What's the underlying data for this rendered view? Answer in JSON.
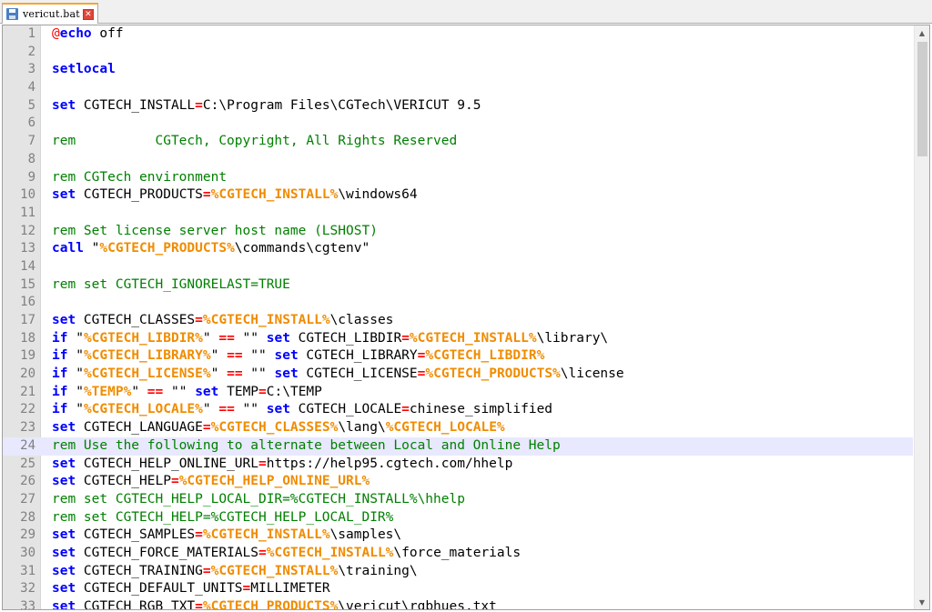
{
  "tab": {
    "filename": "vericut.bat",
    "close_glyph": "✕"
  },
  "scrollbar": {
    "up_glyph": "▲",
    "down_glyph": "▼"
  },
  "editor": {
    "current_line": 24,
    "colors": {
      "keyword": "#0000ff",
      "operator": "#ff0000",
      "variable": "#f08c00",
      "comment": "#008000",
      "gutter": "#e4e4e4",
      "current_line_bg": "#e8e8ff"
    },
    "lines": [
      {
        "n": "1",
        "tokens": [
          [
            "at",
            "@"
          ],
          [
            "kw",
            "echo"
          ],
          [
            "cmd",
            " off"
          ]
        ]
      },
      {
        "n": "2",
        "tokens": []
      },
      {
        "n": "3",
        "tokens": [
          [
            "kw",
            "setlocal"
          ]
        ]
      },
      {
        "n": "4",
        "tokens": []
      },
      {
        "n": "5",
        "tokens": [
          [
            "kw",
            "set"
          ],
          [
            "cmd",
            " CGTECH_INSTALL"
          ],
          [
            "op",
            "="
          ],
          [
            "cmd",
            "C:\\Program Files\\CGTech\\VERICUT 9.5"
          ]
        ]
      },
      {
        "n": "6",
        "tokens": []
      },
      {
        "n": "7",
        "tokens": [
          [
            "rem",
            "rem          CGTech, Copyright, All Rights Reserved"
          ]
        ]
      },
      {
        "n": "8",
        "tokens": []
      },
      {
        "n": "9",
        "tokens": [
          [
            "rem",
            "rem CGTech environment"
          ]
        ]
      },
      {
        "n": "10",
        "tokens": [
          [
            "kw",
            "set"
          ],
          [
            "cmd",
            " CGTECH_PRODUCTS"
          ],
          [
            "op",
            "="
          ],
          [
            "var",
            "%CGTECH_INSTALL%"
          ],
          [
            "cmd",
            "\\windows64"
          ]
        ]
      },
      {
        "n": "11",
        "tokens": []
      },
      {
        "n": "12",
        "tokens": [
          [
            "rem",
            "rem Set license server host name (LSHOST)"
          ]
        ]
      },
      {
        "n": "13",
        "tokens": [
          [
            "kw",
            "call"
          ],
          [
            "cmd",
            " \""
          ],
          [
            "var",
            "%CGTECH_PRODUCTS%"
          ],
          [
            "cmd",
            "\\commands\\cgtenv\""
          ]
        ]
      },
      {
        "n": "14",
        "tokens": []
      },
      {
        "n": "15",
        "tokens": [
          [
            "rem",
            "rem set CGTECH_IGNORELAST=TRUE"
          ]
        ]
      },
      {
        "n": "16",
        "tokens": []
      },
      {
        "n": "17",
        "tokens": [
          [
            "kw",
            "set"
          ],
          [
            "cmd",
            " CGTECH_CLASSES"
          ],
          [
            "op",
            "="
          ],
          [
            "var",
            "%CGTECH_INSTALL%"
          ],
          [
            "cmd",
            "\\classes"
          ]
        ]
      },
      {
        "n": "18",
        "tokens": [
          [
            "kw",
            "if"
          ],
          [
            "cmd",
            " \""
          ],
          [
            "var",
            "%CGTECH_LIBDIR%"
          ],
          [
            "cmd",
            "\" "
          ],
          [
            "op",
            "=="
          ],
          [
            "cmd",
            " \"\" "
          ],
          [
            "kw",
            "set"
          ],
          [
            "cmd",
            " CGTECH_LIBDIR"
          ],
          [
            "op",
            "="
          ],
          [
            "var",
            "%CGTECH_INSTALL%"
          ],
          [
            "cmd",
            "\\library\\"
          ]
        ]
      },
      {
        "n": "19",
        "tokens": [
          [
            "kw",
            "if"
          ],
          [
            "cmd",
            " \""
          ],
          [
            "var",
            "%CGTECH_LIBRARY%"
          ],
          [
            "cmd",
            "\" "
          ],
          [
            "op",
            "=="
          ],
          [
            "cmd",
            " \"\" "
          ],
          [
            "kw",
            "set"
          ],
          [
            "cmd",
            " CGTECH_LIBRARY"
          ],
          [
            "op",
            "="
          ],
          [
            "var",
            "%CGTECH_LIBDIR%"
          ]
        ]
      },
      {
        "n": "20",
        "tokens": [
          [
            "kw",
            "if"
          ],
          [
            "cmd",
            " \""
          ],
          [
            "var",
            "%CGTECH_LICENSE%"
          ],
          [
            "cmd",
            "\" "
          ],
          [
            "op",
            "=="
          ],
          [
            "cmd",
            " \"\" "
          ],
          [
            "kw",
            "set"
          ],
          [
            "cmd",
            " CGTECH_LICENSE"
          ],
          [
            "op",
            "="
          ],
          [
            "var",
            "%CGTECH_PRODUCTS%"
          ],
          [
            "cmd",
            "\\license"
          ]
        ]
      },
      {
        "n": "21",
        "tokens": [
          [
            "kw",
            "if"
          ],
          [
            "cmd",
            " \""
          ],
          [
            "var",
            "%TEMP%"
          ],
          [
            "cmd",
            "\" "
          ],
          [
            "op",
            "=="
          ],
          [
            "cmd",
            " \"\" "
          ],
          [
            "kw",
            "set"
          ],
          [
            "cmd",
            " TEMP"
          ],
          [
            "op",
            "="
          ],
          [
            "cmd",
            "C:\\TEMP"
          ]
        ]
      },
      {
        "n": "22",
        "tokens": [
          [
            "kw",
            "if"
          ],
          [
            "cmd",
            " \""
          ],
          [
            "var",
            "%CGTECH_LOCALE%"
          ],
          [
            "cmd",
            "\" "
          ],
          [
            "op",
            "=="
          ],
          [
            "cmd",
            " \"\" "
          ],
          [
            "kw",
            "set"
          ],
          [
            "cmd",
            " CGTECH_LOCALE"
          ],
          [
            "op",
            "="
          ],
          [
            "cmd",
            "chinese_simplified"
          ]
        ]
      },
      {
        "n": "23",
        "tokens": [
          [
            "kw",
            "set"
          ],
          [
            "cmd",
            " CGTECH_LANGUAGE"
          ],
          [
            "op",
            "="
          ],
          [
            "var",
            "%CGTECH_CLASSES%"
          ],
          [
            "cmd",
            "\\lang\\"
          ],
          [
            "var",
            "%CGTECH_LOCALE%"
          ]
        ]
      },
      {
        "n": "24",
        "tokens": [
          [
            "rem",
            "rem Use the following to alternate between Local and Online Help"
          ]
        ]
      },
      {
        "n": "25",
        "tokens": [
          [
            "kw",
            "set"
          ],
          [
            "cmd",
            " CGTECH_HELP_ONLINE_URL"
          ],
          [
            "op",
            "="
          ],
          [
            "cmd",
            "https://help95.cgtech.com/hhelp"
          ]
        ]
      },
      {
        "n": "26",
        "tokens": [
          [
            "kw",
            "set"
          ],
          [
            "cmd",
            " CGTECH_HELP"
          ],
          [
            "op",
            "="
          ],
          [
            "var",
            "%CGTECH_HELP_ONLINE_URL%"
          ]
        ]
      },
      {
        "n": "27",
        "tokens": [
          [
            "rem",
            "rem set CGTECH_HELP_LOCAL_DIR=%CGTECH_INSTALL%\\hhelp"
          ]
        ]
      },
      {
        "n": "28",
        "tokens": [
          [
            "rem",
            "rem set CGTECH_HELP=%CGTECH_HELP_LOCAL_DIR%"
          ]
        ]
      },
      {
        "n": "29",
        "tokens": [
          [
            "kw",
            "set"
          ],
          [
            "cmd",
            " CGTECH_SAMPLES"
          ],
          [
            "op",
            "="
          ],
          [
            "var",
            "%CGTECH_INSTALL%"
          ],
          [
            "cmd",
            "\\samples\\"
          ]
        ]
      },
      {
        "n": "30",
        "tokens": [
          [
            "kw",
            "set"
          ],
          [
            "cmd",
            " CGTECH_FORCE_MATERIALS"
          ],
          [
            "op",
            "="
          ],
          [
            "var",
            "%CGTECH_INSTALL%"
          ],
          [
            "cmd",
            "\\force_materials"
          ]
        ]
      },
      {
        "n": "31",
        "tokens": [
          [
            "kw",
            "set"
          ],
          [
            "cmd",
            " CGTECH_TRAINING"
          ],
          [
            "op",
            "="
          ],
          [
            "var",
            "%CGTECH_INSTALL%"
          ],
          [
            "cmd",
            "\\training\\"
          ]
        ]
      },
      {
        "n": "32",
        "tokens": [
          [
            "kw",
            "set"
          ],
          [
            "cmd",
            " CGTECH_DEFAULT_UNITS"
          ],
          [
            "op",
            "="
          ],
          [
            "cmd",
            "MILLIMETER"
          ]
        ]
      },
      {
        "n": "33",
        "tokens": [
          [
            "kw",
            "set"
          ],
          [
            "cmd",
            " CGTECH_RGB_TXT"
          ],
          [
            "op",
            "="
          ],
          [
            "var",
            "%CGTECH_PRODUCTS%"
          ],
          [
            "cmd",
            "\\vericut\\rgbhues.txt"
          ]
        ]
      }
    ]
  }
}
